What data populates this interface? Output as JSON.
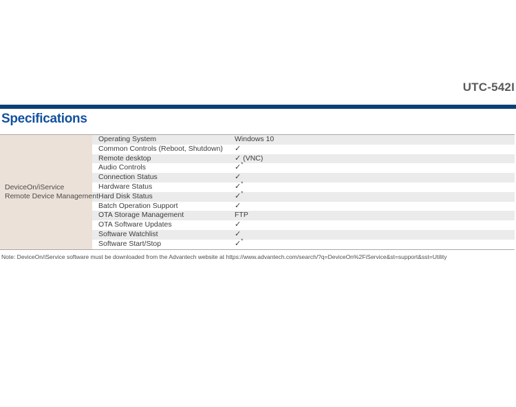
{
  "header": {
    "model_title": "UTC-542I",
    "rule_color": "#0d3f76"
  },
  "section": {
    "heading": "Specifications",
    "heading_color": "#12519e"
  },
  "table": {
    "group_label_line1": "DeviceOn/iService",
    "group_label_line2": "Remote Device Management",
    "group_bg": "#ece1d8",
    "stripe_bg": "#ebebeb",
    "rows": [
      {
        "feature": "Operating System",
        "value": "Windows 10",
        "check": false,
        "star": false,
        "suffix": ""
      },
      {
        "feature": "Common Controls (Reboot, Shutdown)",
        "value": "",
        "check": true,
        "star": false,
        "suffix": ""
      },
      {
        "feature": "Remote desktop",
        "value": "",
        "check": true,
        "star": false,
        "suffix": "(VNC)"
      },
      {
        "feature": "Audio Controls",
        "value": "",
        "check": true,
        "star": true,
        "suffix": ""
      },
      {
        "feature": "Connection Status",
        "value": "",
        "check": true,
        "star": false,
        "suffix": ""
      },
      {
        "feature": "Hardware Status",
        "value": "",
        "check": true,
        "star": true,
        "suffix": ""
      },
      {
        "feature": "Hard Disk Status",
        "value": "",
        "check": true,
        "star": true,
        "suffix": ""
      },
      {
        "feature": "Batch Operation Support",
        "value": "",
        "check": true,
        "star": false,
        "suffix": ""
      },
      {
        "feature": "OTA Storage Management",
        "value": "FTP",
        "check": false,
        "star": false,
        "suffix": ""
      },
      {
        "feature": "OTA Software Updates",
        "value": "",
        "check": true,
        "star": false,
        "suffix": ""
      },
      {
        "feature": "Software Watchlist",
        "value": "",
        "check": true,
        "star": false,
        "suffix": ""
      },
      {
        "feature": "Software Start/Stop",
        "value": "",
        "check": true,
        "star": true,
        "suffix": ""
      }
    ]
  },
  "footnote": {
    "text": "Note: DeviceOn/iService software must be downloaded from the Advantech website at https://www.advantech.com/search/?q=DeviceOn%2FiService&st=support&sst=Utility"
  }
}
